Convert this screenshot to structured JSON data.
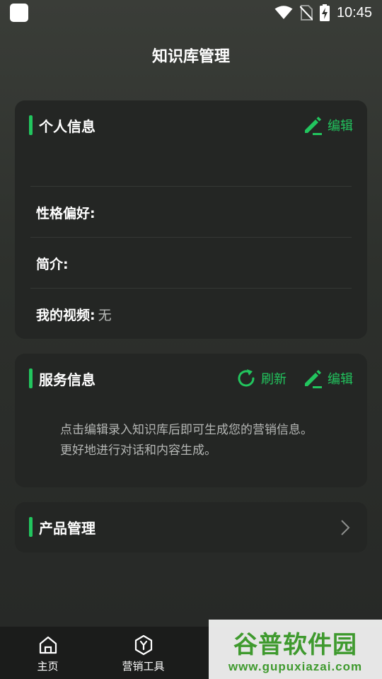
{
  "status_bar": {
    "time": "10:45"
  },
  "header": {
    "title": "知识库管理"
  },
  "personal_card": {
    "title": "个人信息",
    "edit_label": "编辑",
    "rows": [
      {
        "label": "性格偏好:",
        "value": ""
      },
      {
        "label": "简介:",
        "value": ""
      },
      {
        "label": "我的视频:",
        "value": "无"
      }
    ]
  },
  "service_card": {
    "title": "服务信息",
    "refresh_label": "刷新",
    "edit_label": "编辑",
    "description": "点击编辑录入知识库后即可生成您的营销信息。更好地进行对话和内容生成。"
  },
  "product_card": {
    "title": "产品管理"
  },
  "tab_bar": {
    "tabs": [
      {
        "label": "主页",
        "icon": "home-icon"
      },
      {
        "label": "营销工具",
        "icon": "hexagon-y-icon"
      }
    ]
  },
  "watermark": {
    "main": "谷普软件园",
    "sub": "www.gupuxiazai.com"
  },
  "colors": {
    "accent": "#22c55e",
    "card": "#242624",
    "tab_bar": "#1b1c1b"
  }
}
